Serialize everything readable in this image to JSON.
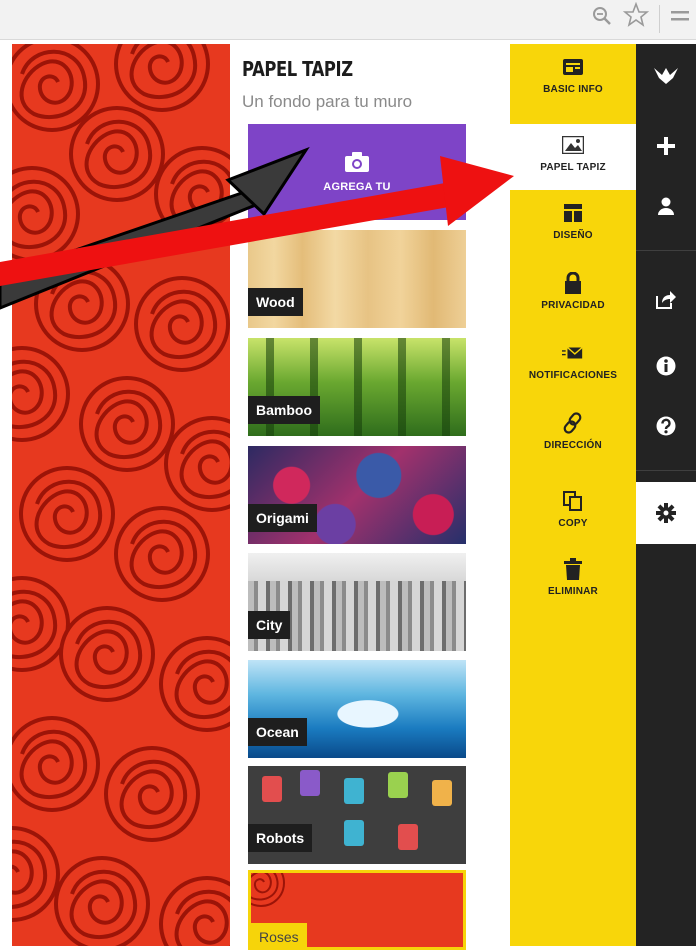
{
  "browser": {
    "icons": [
      "zoom-icon",
      "star-icon",
      "menu-icon"
    ]
  },
  "wallpaper_panel": {
    "title": "PAPEL TAPIZ",
    "subtitle": "Un fondo para tu muro",
    "add_button_label": "AGREGA TU",
    "thumbnails": [
      {
        "label": "Wood"
      },
      {
        "label": "Bamboo"
      },
      {
        "label": "Origami"
      },
      {
        "label": "City"
      },
      {
        "label": "Ocean"
      },
      {
        "label": "Robots"
      },
      {
        "label": "Roses"
      }
    ],
    "selected": "Roses"
  },
  "settings_menu": {
    "active": "PAPEL TAPIZ",
    "items": [
      {
        "label": "BASIC INFO",
        "icon": "card-icon"
      },
      {
        "label": "PAPEL TAPIZ",
        "icon": "image-icon"
      },
      {
        "label": "DISEÑO",
        "icon": "layout-icon"
      },
      {
        "label": "PRIVACIDAD",
        "icon": "lock-icon"
      },
      {
        "label": "NOTIFICACIONES",
        "icon": "envelope-icon"
      },
      {
        "label": "DIRECCIÓN",
        "icon": "link-icon"
      },
      {
        "label": "COPY",
        "icon": "copy-icon"
      },
      {
        "label": "ELIMINAR",
        "icon": "trash-icon"
      }
    ]
  },
  "side_rail": {
    "items": [
      "bird-logo-icon",
      "plus-icon",
      "user-icon",
      "share-icon",
      "info-icon",
      "help-icon",
      "gear-icon"
    ],
    "active": "gear-icon"
  },
  "colors": {
    "menu_yellow": "#f8d60a",
    "add_purple": "#7e44c7",
    "rail_dark": "#232323",
    "roses_red": "#e7391f",
    "arrow_red": "#ee1111",
    "arrow_gray": "#3a3a3a"
  }
}
